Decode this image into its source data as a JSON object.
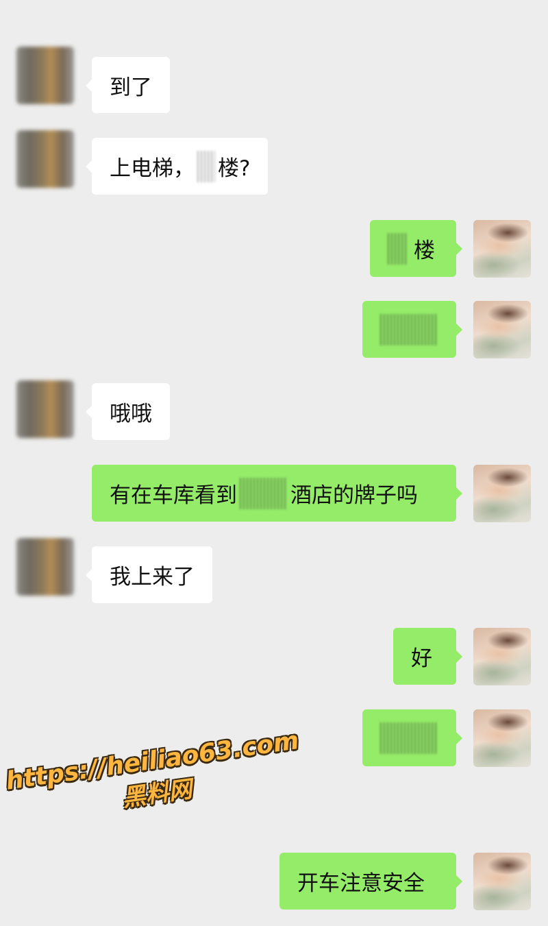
{
  "messages": [
    {
      "side": "other",
      "text": "到了"
    },
    {
      "side": "other",
      "text_before": "上电梯，",
      "text_after": "楼?"
    },
    {
      "side": "self",
      "text_after": "楼"
    },
    {
      "side": "self"
    },
    {
      "side": "other",
      "text": "哦哦"
    },
    {
      "side": "self",
      "text_before": "有在车库看到",
      "text_after": "酒店的牌子吗"
    },
    {
      "side": "other",
      "text": "我上来了"
    },
    {
      "side": "self",
      "text": "好"
    },
    {
      "side": "self"
    },
    {
      "side": "self",
      "text": "开车注意安全"
    }
  ],
  "watermark": {
    "url": "https://heiliao63.com",
    "name": "黑料网",
    "color": "#ffb640"
  },
  "colors": {
    "background": "#ededed",
    "self_bubble": "#95ec69",
    "other_bubble": "#ffffff"
  }
}
